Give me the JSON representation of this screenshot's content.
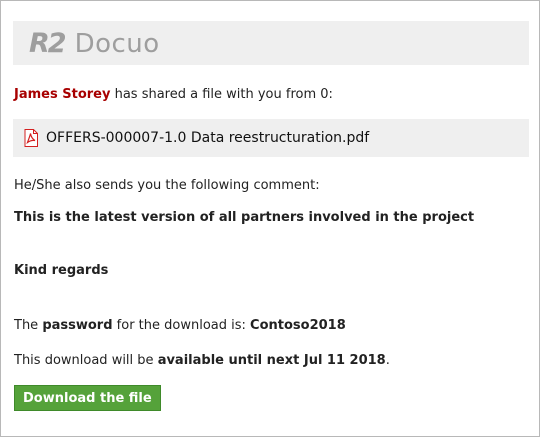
{
  "header": {
    "logo_mark": "R2",
    "logo_word": "Docuo"
  },
  "intro": {
    "sender": "James Storey",
    "text": " has shared a file with you from 0:"
  },
  "file": {
    "name": "OFFERS-000007-1.0 Data reestructuration.pdf",
    "icon": "pdf-file-icon"
  },
  "comment": {
    "intro": "He/She also sends you the following comment:",
    "line1": "This is the latest version of all partners involved in the project",
    "line2": "Kind regards"
  },
  "password": {
    "prefix": "The ",
    "keyword": "password",
    "middle": " for the download is: ",
    "value": "Contoso2018"
  },
  "availability": {
    "prefix": "This download will be ",
    "emphasis": "available until next Jul 11 2018",
    "suffix": "."
  },
  "download_button": {
    "label": "Download the file"
  },
  "colors": {
    "sender": "#a80000",
    "button": "#55a23a",
    "header_bg": "#efefef",
    "pdf_icon": "#d32020"
  }
}
